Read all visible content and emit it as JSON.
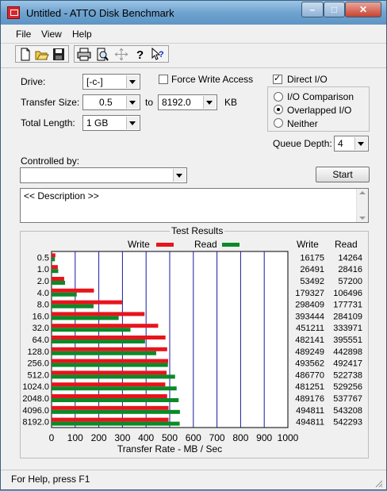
{
  "window": {
    "title": "Untitled - ATTO Disk Benchmark"
  },
  "menu": [
    "File",
    "View",
    "Help"
  ],
  "toolbar": {
    "buttons": [
      "new-icon",
      "open-icon",
      "save-icon",
      "print-icon",
      "print-preview-icon",
      "move-icon",
      "help-icon",
      "context-help-icon"
    ]
  },
  "settings": {
    "drive_label": "Drive:",
    "drive_value": "[-c-]",
    "force_write_label": "Force Write Access",
    "force_write_checked": false,
    "direct_io_label": "Direct I/O",
    "direct_io_checked": true,
    "transfer_size_label": "Transfer Size:",
    "transfer_from": "0.5",
    "to_label": "to",
    "transfer_to": "8192.0",
    "kb_label": "KB",
    "total_length_label": "Total Length:",
    "total_length_value": "1 GB",
    "io_mode_options": [
      {
        "label": "I/O Comparison",
        "selected": false
      },
      {
        "label": "Overlapped I/O",
        "selected": true
      },
      {
        "label": "Neither",
        "selected": false
      }
    ],
    "queue_depth_label": "Queue Depth:",
    "queue_depth_value": "4",
    "controlled_by_label": "Controlled by:",
    "controlled_by_value": "",
    "start_label": "Start",
    "description": "<< Description >>"
  },
  "results": {
    "title": "Test Results",
    "write_col": "Write",
    "read_col": "Read",
    "legend_write": "Write",
    "legend_read": "Read",
    "write_color": "#e8141c",
    "read_color": "#0a8a28"
  },
  "chart_data": {
    "type": "bar",
    "orientation": "horizontal",
    "categories": [
      "0.5",
      "1.0",
      "2.0",
      "4.0",
      "8.0",
      "16.0",
      "32.0",
      "64.0",
      "128.0",
      "256.0",
      "512.0",
      "1024.0",
      "2048.0",
      "4096.0",
      "8192.0"
    ],
    "series": [
      {
        "name": "Write",
        "values": [
          16175,
          26491,
          53492,
          179327,
          298409,
          393444,
          451211,
          482141,
          489249,
          493562,
          486770,
          481251,
          489176,
          494811,
          494811
        ]
      },
      {
        "name": "Read",
        "values": [
          14264,
          28416,
          57200,
          106496,
          177731,
          284109,
          333971,
          395551,
          442898,
          492417,
          522738,
          529256,
          537767,
          543208,
          542293
        ]
      }
    ],
    "xlabel": "Transfer Rate - MB / Sec",
    "x_ticks": [
      "0",
      "100",
      "200",
      "300",
      "400",
      "500",
      "600",
      "700",
      "800",
      "900",
      "1000"
    ],
    "xlim": [
      0,
      1000
    ],
    "value_units": "KB/s",
    "grid": true,
    "legend": "top"
  },
  "status": {
    "text": "For Help, press F1"
  }
}
